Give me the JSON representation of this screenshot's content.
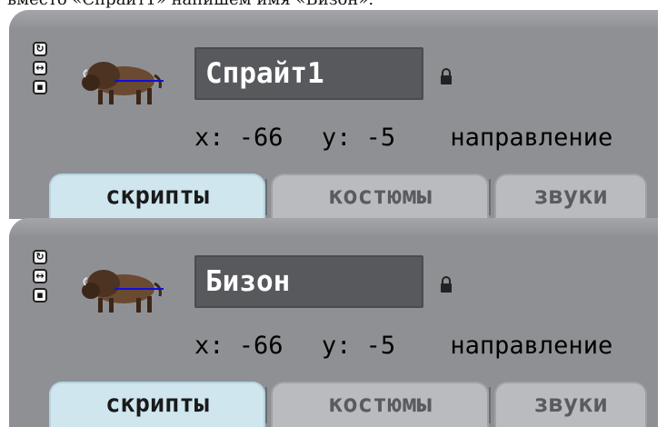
{
  "caption": "вместо «Спрайт1» напишем имя «Бизон».",
  "panels": [
    {
      "sprite_name": "Спрайт1",
      "x_label": "x:",
      "x_value": "-66",
      "y_label": "y:",
      "y_value": "-5",
      "direction_label": "направление",
      "tabs": [
        "скрипты",
        "костюмы",
        "звуки"
      ],
      "active_tab": "скрипты"
    },
    {
      "sprite_name": "Бизон",
      "x_label": "x:",
      "x_value": "-66",
      "y_label": "y:",
      "y_value": "-5",
      "direction_label": "направление",
      "tabs": [
        "скрипты",
        "костюмы",
        "звуки"
      ],
      "active_tab": "скрипты"
    }
  ],
  "icons": [
    "rotate-all-around-icon",
    "left-right-flip-icon",
    "no-rotate-icon",
    "bison-sprite-icon",
    "lock-icon"
  ]
}
